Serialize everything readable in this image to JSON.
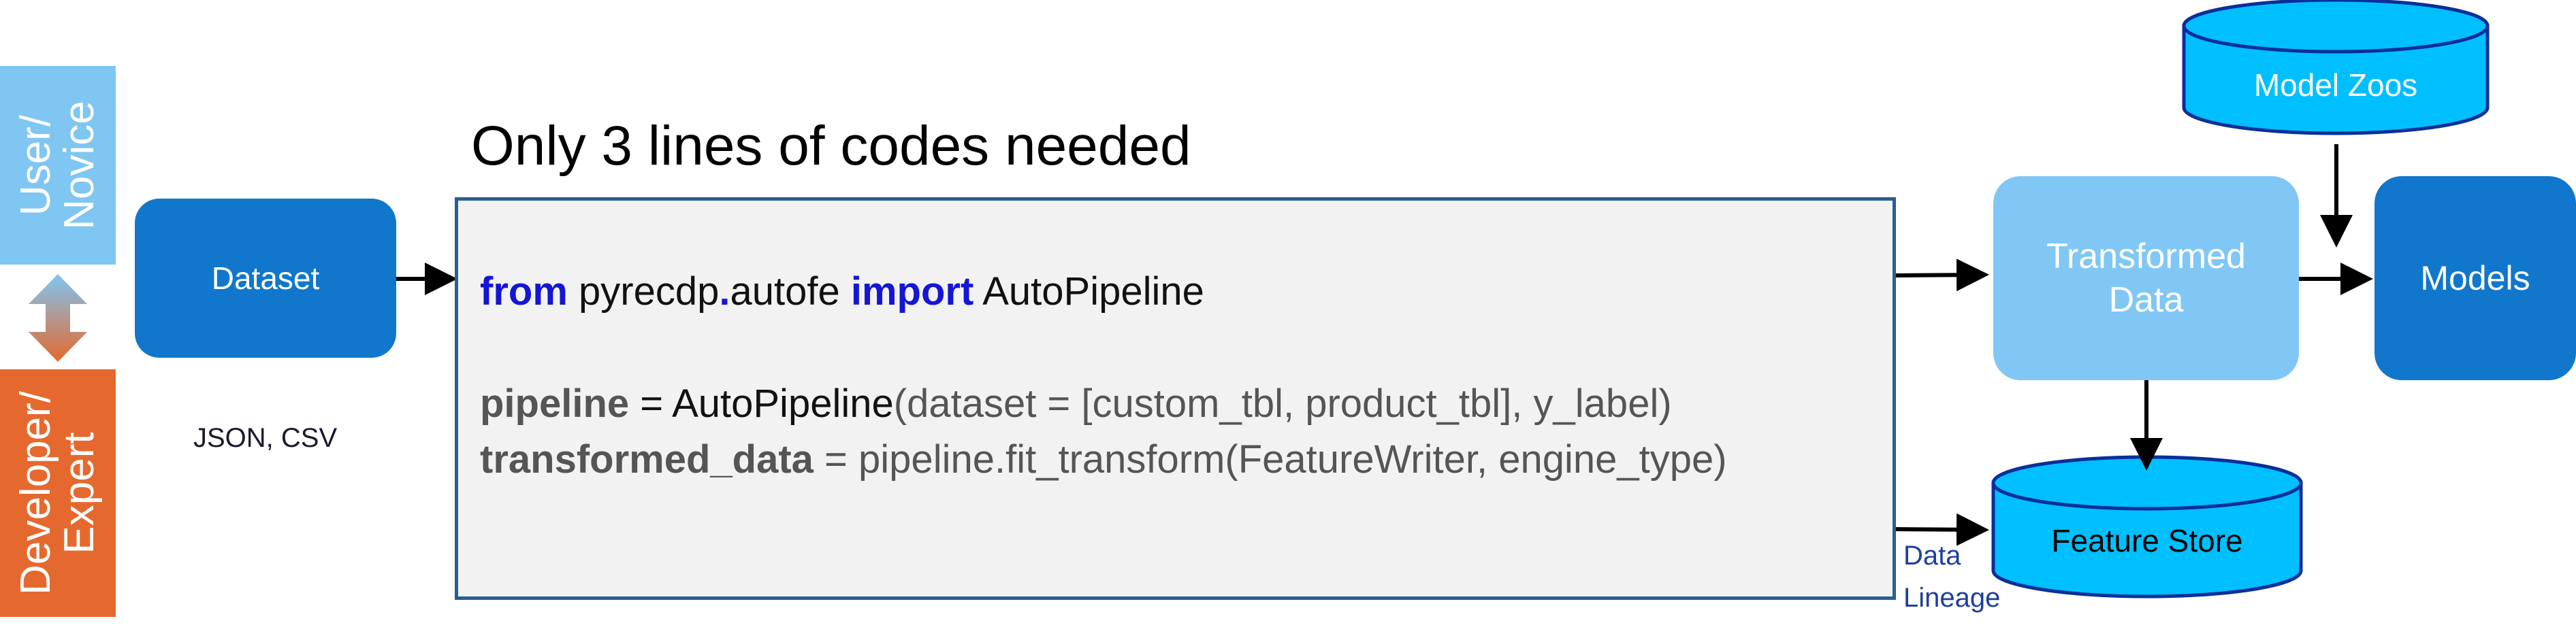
{
  "roles": {
    "user": "User/\nNovice",
    "developer": "Developer/\nExpert"
  },
  "nodes": {
    "dataset": "Dataset",
    "dataset_formats": "JSON, CSV",
    "transformed": "Transformed\nData",
    "models": "Models",
    "model_zoos": "Model Zoos",
    "feature_store": "Feature Store",
    "data_lineage": "Data\nLineage"
  },
  "headline": "Only 3 lines of codes needed",
  "code": {
    "line1": {
      "kw_from": "from",
      "module_a": "pyrecdp",
      "dot": ".",
      "module_b": "autofe",
      "kw_import": "import",
      "name": "AutoPipeline"
    },
    "line2": {
      "var": "pipeline",
      "eq": " = ",
      "call": "AutoPipeline",
      "args": "(dataset = [custom_tbl, product_tbl], y_label)"
    },
    "line3": {
      "var": "transformed_data",
      "eq": " = ",
      "call": "pipeline.fit_transform(FeatureWriter, engine_type)"
    }
  },
  "colors": {
    "user_role": "#7fc6f2",
    "developer_role": "#e5692e",
    "dataset": "#1177cc",
    "transformed": "#80c7f5",
    "models": "#1177cc",
    "cylinder": "#00bfff",
    "cylinder_outline": "#0a2f9a",
    "keyword": "#1515d6",
    "panel_border": "#2a5d93"
  }
}
